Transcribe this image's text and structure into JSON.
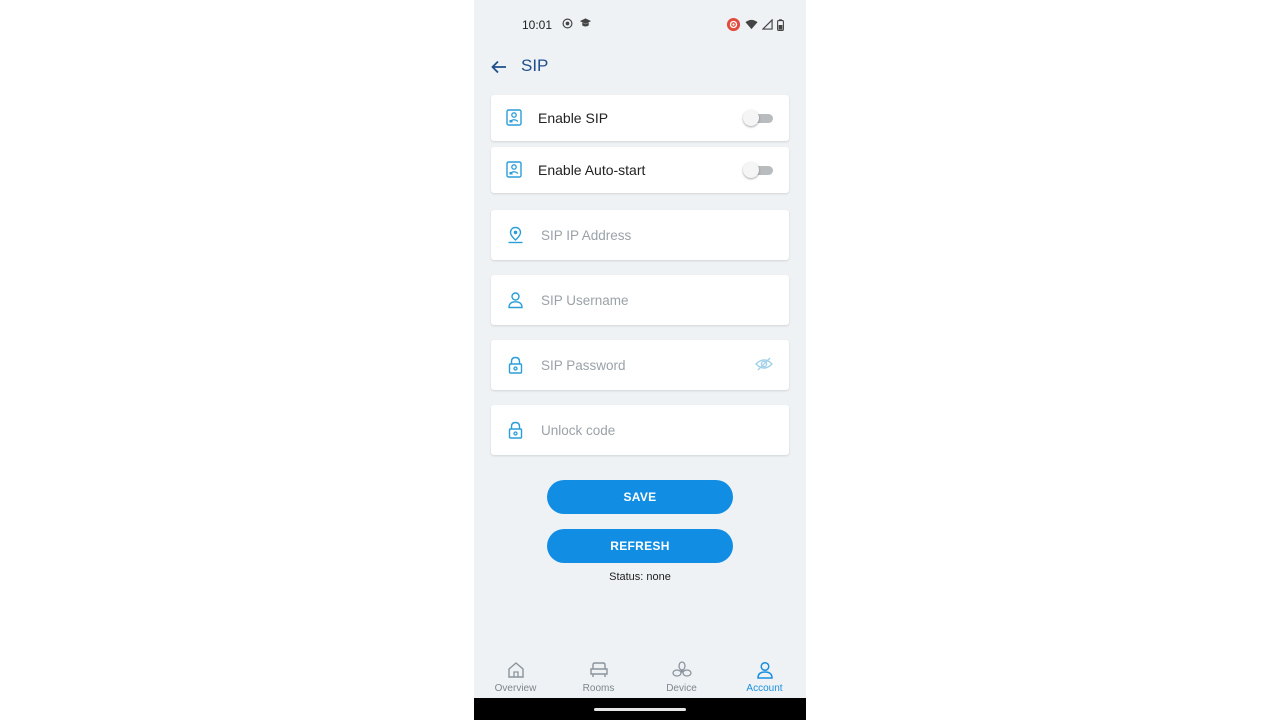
{
  "status_bar": {
    "time": "10:01"
  },
  "header": {
    "title": "SIP"
  },
  "toggles": [
    {
      "label": "Enable SIP",
      "on": false
    },
    {
      "label": "Enable Auto-start",
      "on": false
    }
  ],
  "fields": {
    "ip": {
      "placeholder": "SIP IP Address",
      "value": ""
    },
    "username": {
      "placeholder": "SIP Username",
      "value": ""
    },
    "password": {
      "placeholder": "SIP Password",
      "value": ""
    },
    "unlock": {
      "placeholder": "Unlock code",
      "value": ""
    }
  },
  "buttons": {
    "save": "SAVE",
    "refresh": "REFRESH"
  },
  "status": "Status: none",
  "nav": [
    {
      "label": "Overview",
      "icon": "home-icon",
      "active": false
    },
    {
      "label": "Rooms",
      "icon": "sofa-icon",
      "active": false
    },
    {
      "label": "Device",
      "icon": "fan-icon",
      "active": false
    },
    {
      "label": "Account",
      "icon": "person-icon",
      "active": true
    }
  ],
  "colors": {
    "accent": "#118ee4",
    "title": "#1f4f8a",
    "background": "#eef2f4",
    "icon": "#2a9ed8"
  }
}
